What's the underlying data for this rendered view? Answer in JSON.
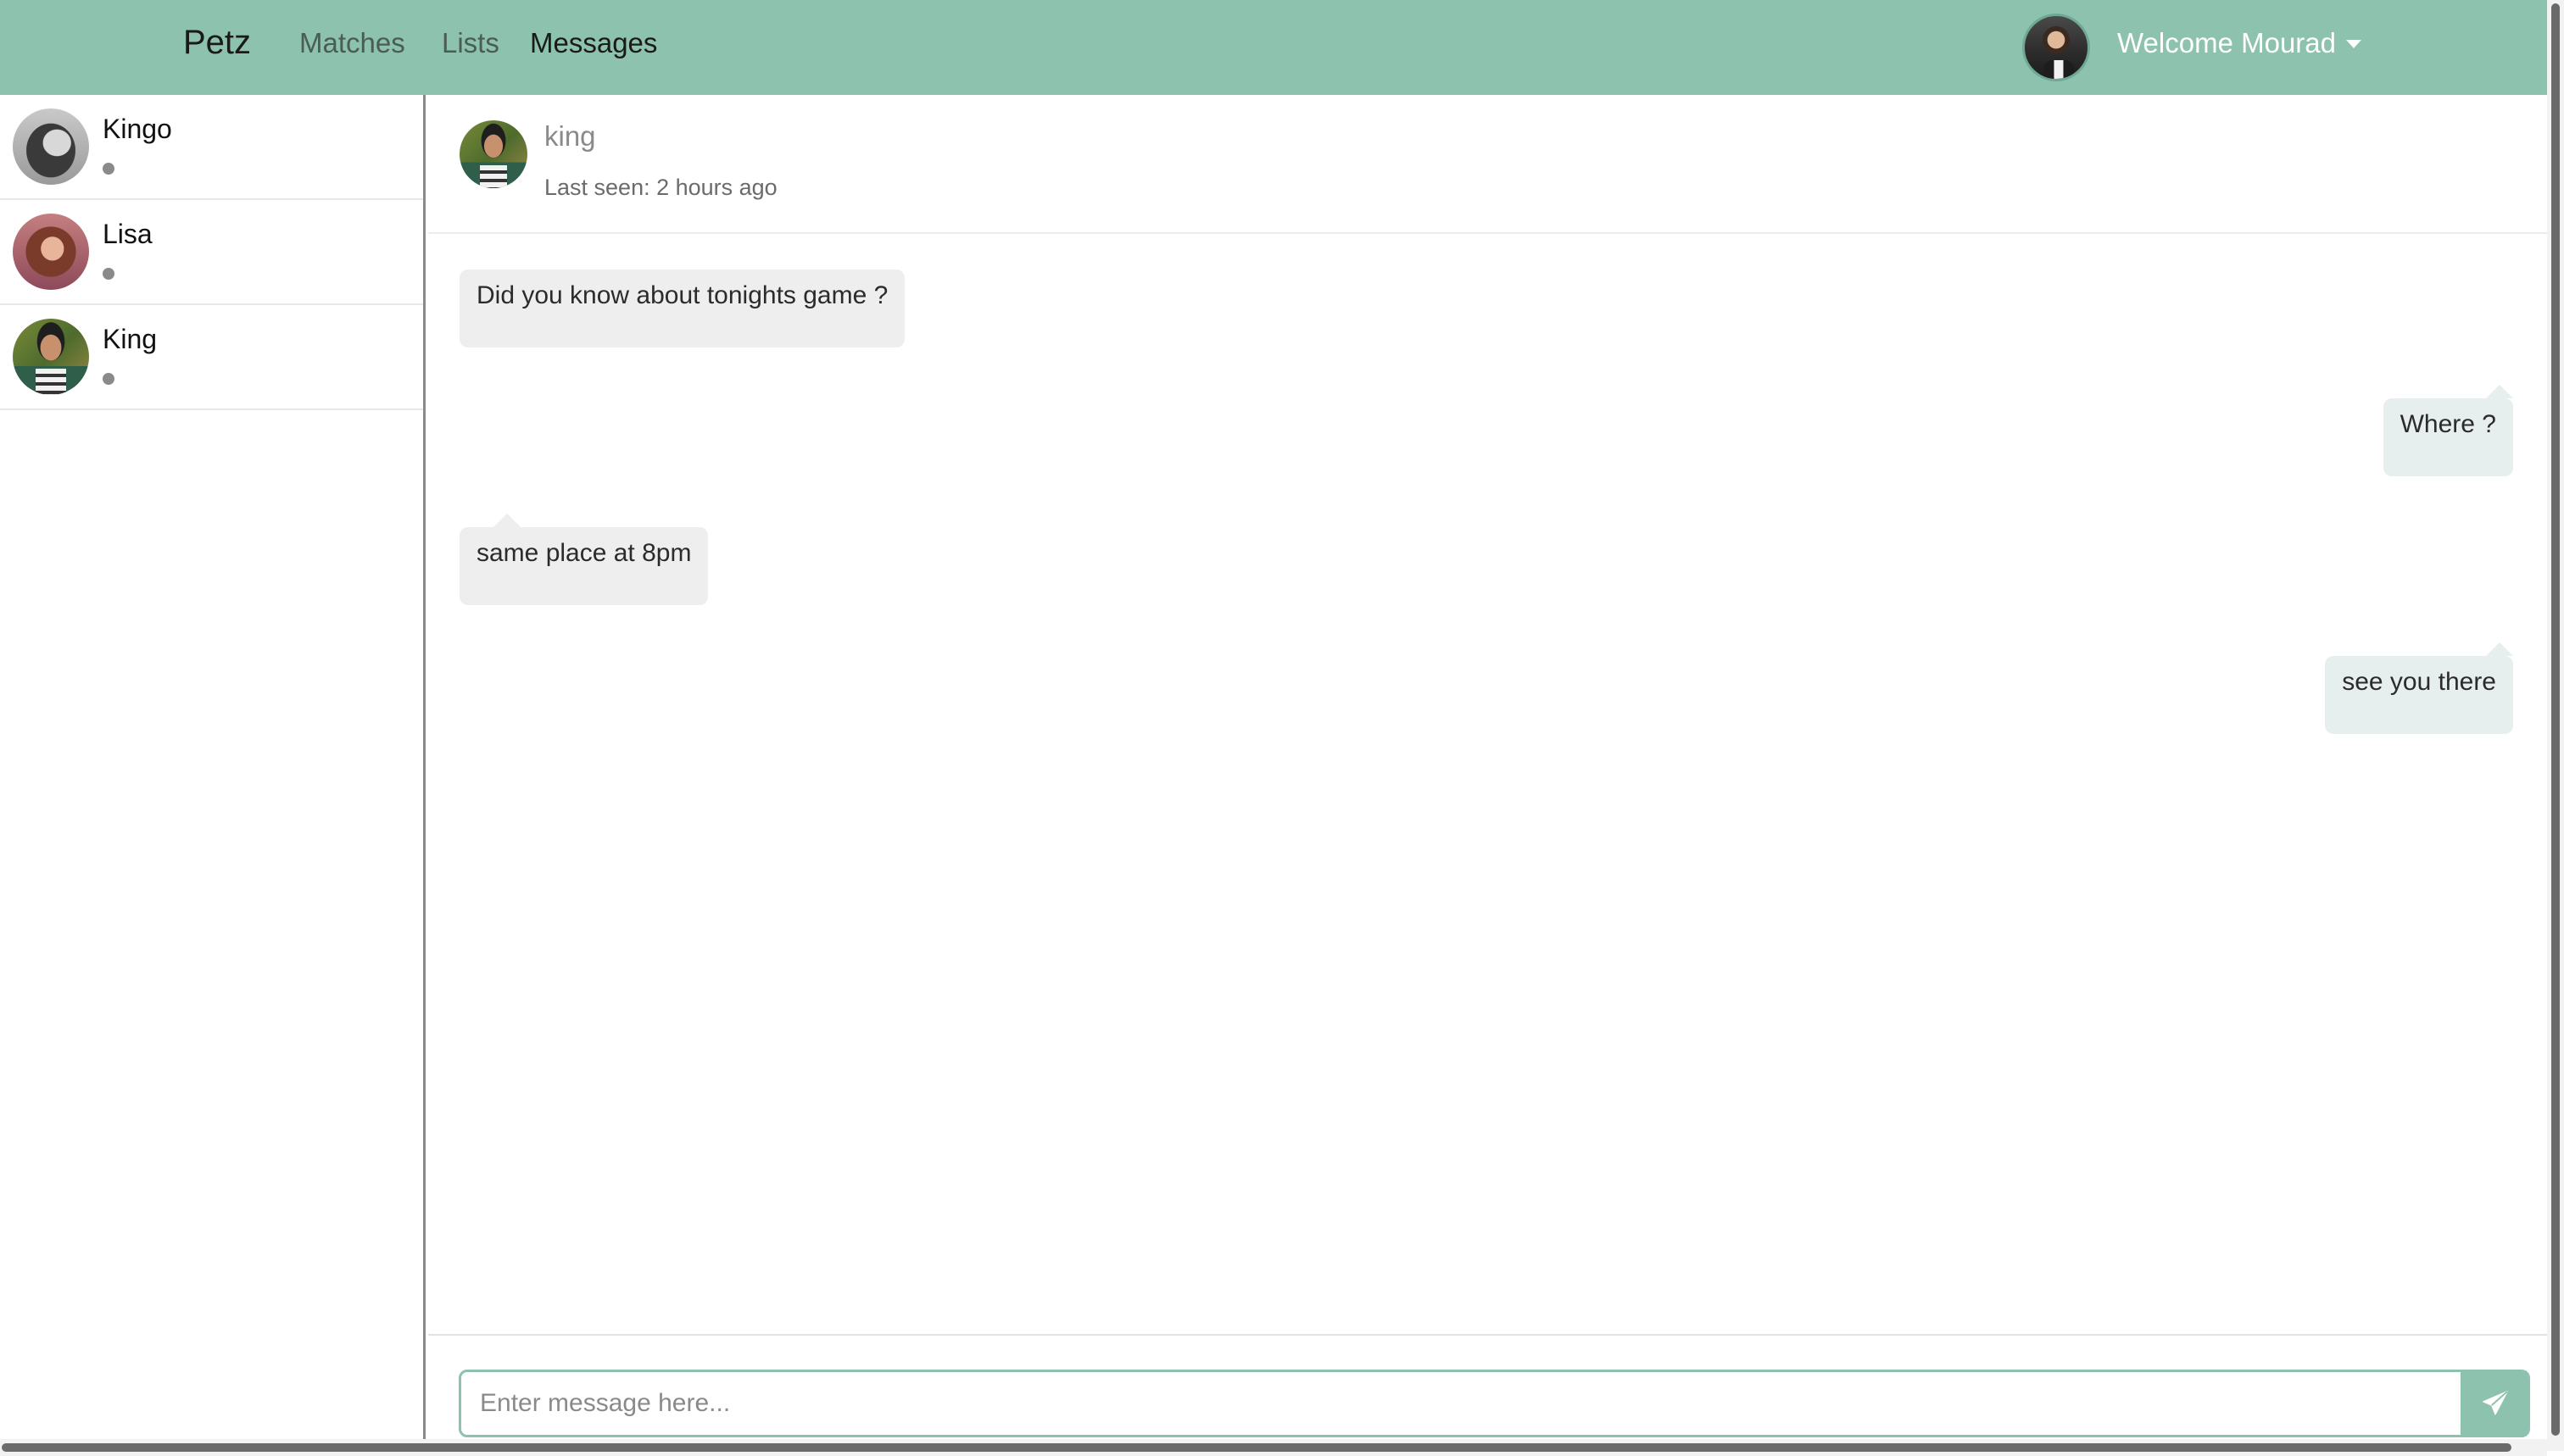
{
  "navbar": {
    "brand": "Petz",
    "links": [
      "Matches",
      "Lists",
      "Messages"
    ],
    "active_link": "Messages",
    "welcome": "Welcome Mourad",
    "accent_color": "#8cc2ae"
  },
  "sidebar": {
    "contacts": [
      {
        "name": "Kingo",
        "status_color": "#8a8a8a"
      },
      {
        "name": "Lisa",
        "status_color": "#8a8a8a"
      },
      {
        "name": "King",
        "status_color": "#8a8a8a"
      }
    ]
  },
  "chat": {
    "title": "king",
    "last_seen": "Last seen: 2 hours ago",
    "messages": [
      {
        "text": "Did you know about tonights game ?",
        "direction": "in"
      },
      {
        "text": "Where ?",
        "direction": "out"
      },
      {
        "text": "same place at 8pm",
        "direction": "in"
      },
      {
        "text": "see you there",
        "direction": "out"
      }
    ]
  },
  "composer": {
    "placeholder": "Enter message here...",
    "send_icon": "paper-plane-icon"
  }
}
